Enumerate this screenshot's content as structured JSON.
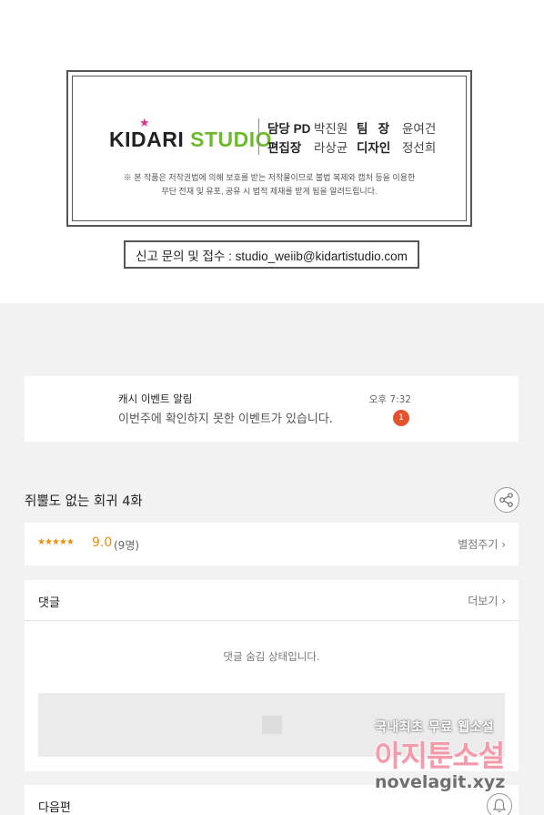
{
  "credits": {
    "logo_kidari": "KIDARI",
    "logo_studio": "STUDIO",
    "rows": [
      {
        "role1": "담당 PD",
        "name1": "박진원",
        "role2": "팀   장",
        "name2": "윤여건"
      },
      {
        "role1": "편집장",
        "name1": "라상균",
        "role2": "디자인",
        "name2": "정선희"
      }
    ],
    "note_line1": "※ 본 작품은 저작권법에 의해 보호를 받는 저작물이므로 불법 복제와 캡처 등을 이용한",
    "note_line2": "무단 전재 및 유포, 공유 시 법적 제재를 받게 됨을 알려드립니다.",
    "report": "신고 문의 및 접수 : studio_weiib@kidartistudio.com"
  },
  "notification": {
    "title": "캐시 이벤트 알림",
    "message": "이번주에 확인하지 못한 이벤트가 있습니다.",
    "time": "오후 7:32",
    "badge": "1"
  },
  "episode": {
    "title": "쥐뿔도 없는 회귀 4화"
  },
  "rating": {
    "stars": "★★★★★",
    "score": "9.0",
    "count": "(9명)",
    "rate_link": "별점주기 ›"
  },
  "comments": {
    "title": "댓글",
    "more": "더보기 ›",
    "hidden_msg": "댓글 숨김 상태입니다."
  },
  "next_episode": {
    "title": "다음편"
  },
  "watermark": {
    "line1": "국내최초 무료 웹소설",
    "line2": "아지툰소설",
    "line3": "novelagit.xyz"
  },
  "colors": {
    "accent_orange": "#e8900f",
    "badge_red": "#e4532d",
    "studio_green": "#6dbb2c",
    "star_pink": "#e0338b"
  }
}
